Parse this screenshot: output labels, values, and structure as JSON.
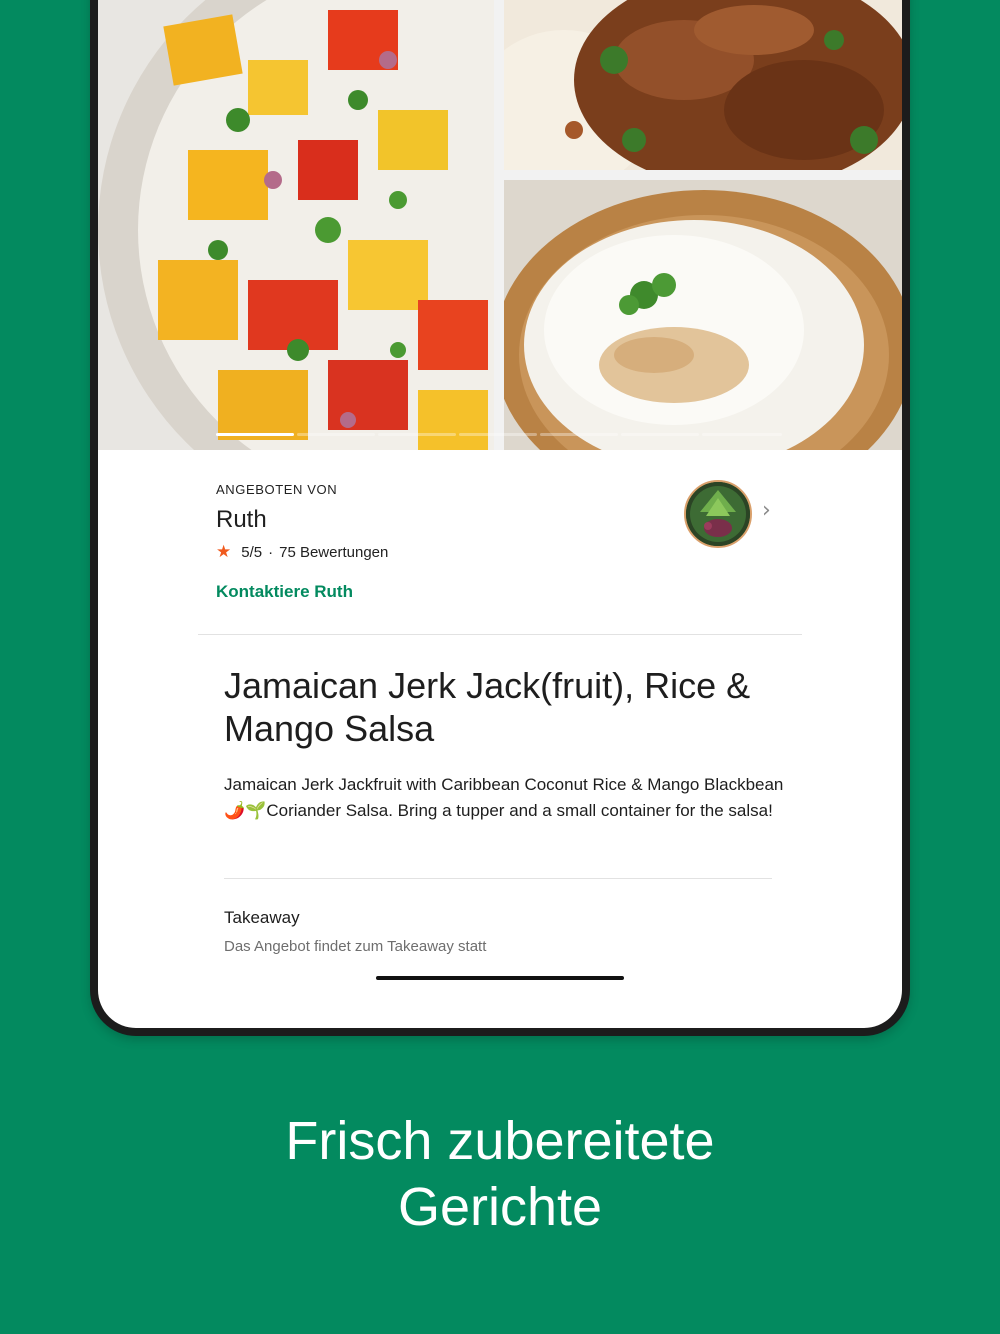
{
  "gallery": {
    "photos": [
      "mango-salsa-photo",
      "jerk-jackfruit-photo",
      "coconut-rice-photo"
    ],
    "pages_total": 7,
    "page_active": 1
  },
  "host": {
    "label": "ANGEBOTEN VON",
    "name": "Ruth",
    "rating": "5/5",
    "separator": "·",
    "reviews": "75 Bewertungen",
    "contact_label": "Kontaktiere Ruth",
    "chevron": "›"
  },
  "dish": {
    "title": "Jamaican Jerk Jack(fruit), Rice & Mango Salsa",
    "description": "Jamaican Jerk Jackfruit with Caribbean Coconut Rice & Mango Blackbean 🌶️🌱Coriander Salsa. Bring a tupper and a small container for the salsa!"
  },
  "pickup": {
    "title": "Takeaway",
    "subtitle": "Das Angebot findet zum Takeaway statt"
  },
  "headline": {
    "line1": "Frisch zubereitete",
    "line2": "Gerichte"
  },
  "colors": {
    "brand_green": "#038a5f",
    "star": "#f05a1e"
  }
}
